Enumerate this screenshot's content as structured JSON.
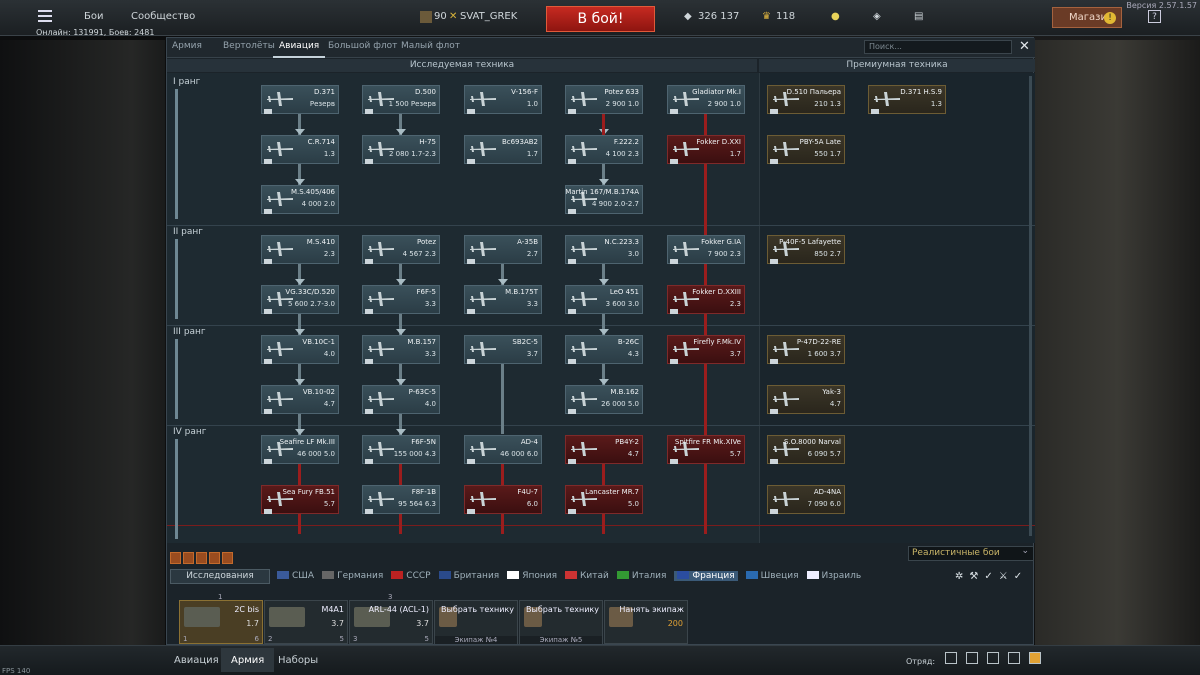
{
  "version": "Версия 2.57.1.57",
  "online": "Онлайн: 131991, Боев: 2481",
  "topbar": {
    "menu": "Бои",
    "community": "Сообщество",
    "level": "90",
    "player": "SVAT_GREK",
    "battle": "В бой!",
    "silver": "326 137",
    "gold": "118",
    "shop": "Магазин",
    "help": "?"
  },
  "tabs": [
    "Армия",
    "Вертолёты",
    "Авиация",
    "Большой флот",
    "Малый флот"
  ],
  "active_tab": "Авиация",
  "search_placeholder": "Поиск...",
  "sections": {
    "research": "Исследуемая техника",
    "premium": "Премиумная техника"
  },
  "ranks": [
    "I ранг",
    "II ранг",
    "III ранг",
    "IV ранг"
  ],
  "planes": [
    {
      "name": "D.371",
      "stat": "Резерв",
      "type": "researched"
    },
    {
      "name": "D.500",
      "stat": "1 500 Резерв",
      "type": "researched"
    },
    {
      "name": "V-156-F",
      "stat": "1.0",
      "type": "researched"
    },
    {
      "name": "Potez 633",
      "stat": "2 900 1.0",
      "type": "researched"
    },
    {
      "name": "Gladiator Mk.I",
      "stat": "2 900 1.0",
      "type": "researched"
    },
    {
      "name": "D.510 Пальера",
      "stat": "210 1.3",
      "type": "prem"
    },
    {
      "name": "D.371 H.S.9",
      "stat": "1.3",
      "type": "prem"
    },
    {
      "name": "C.R.714",
      "stat": "1.3",
      "type": "researched"
    },
    {
      "name": "H-75",
      "stat": "2 080 1.7-2.3",
      "type": "researched"
    },
    {
      "name": "Bc693AB2",
      "stat": "1.7",
      "type": "researched"
    },
    {
      "name": "F.222.2",
      "stat": "4 100 2.3",
      "type": "researched"
    },
    {
      "name": "Fokker D.XXI",
      "stat": "1.7",
      "type": "red"
    },
    {
      "name": "PBY-5A Late",
      "stat": "550 1.7",
      "type": "prem"
    },
    {
      "name": "M.S.405/406",
      "stat": "4 000 2.0",
      "type": "researched"
    },
    {
      "name": "Martin 167/M.B.174A",
      "stat": "4 900 2.0-2.7",
      "type": "researched"
    },
    {
      "name": "M.S.410",
      "stat": "2.3",
      "type": "researched"
    },
    {
      "name": "Potez",
      "stat": "4 567 2.3",
      "type": "researched"
    },
    {
      "name": "A-35B",
      "stat": "2.7",
      "type": "researched"
    },
    {
      "name": "N.C.223.3",
      "stat": "3.0",
      "type": "researched"
    },
    {
      "name": "Fokker G.IA",
      "stat": "7 900 2.3",
      "type": "researched"
    },
    {
      "name": "P-40F-5 Lafayette",
      "stat": "850 2.7",
      "type": "prem"
    },
    {
      "name": "VG.33C/D.520",
      "stat": "5 600 2.7-3.0",
      "type": "researched"
    },
    {
      "name": "F6F-5",
      "stat": "3.3",
      "type": "researched"
    },
    {
      "name": "M.B.175T",
      "stat": "3.3",
      "type": "researched"
    },
    {
      "name": "LeO 451",
      "stat": "3 600 3.0",
      "type": "researched"
    },
    {
      "name": "Fokker D.XXIII",
      "stat": "2.3",
      "type": "red"
    },
    {
      "name": "VB.10C-1",
      "stat": "4.0",
      "type": "researched"
    },
    {
      "name": "M.B.157",
      "stat": "3.3",
      "type": "researched"
    },
    {
      "name": "SB2C-5",
      "stat": "3.7",
      "type": "researched"
    },
    {
      "name": "B-26C",
      "stat": "4.3",
      "type": "researched"
    },
    {
      "name": "Firefly F.Mk.IV",
      "stat": "3.7",
      "type": "red"
    },
    {
      "name": "P-47D-22-RE",
      "stat": "1 600 3.7",
      "type": "prem"
    },
    {
      "name": "VB.10-02",
      "stat": "4.7",
      "type": "researched"
    },
    {
      "name": "P-63C-5",
      "stat": "4.0",
      "type": "researched"
    },
    {
      "name": "M.B.162",
      "stat": "26 000 5.0",
      "type": "researched"
    },
    {
      "name": "Yak-3",
      "stat": "4.7",
      "type": "prem"
    },
    {
      "name": "Seafire LF Mk.III",
      "stat": "46 000 5.0",
      "type": "researched"
    },
    {
      "name": "F6F-5N",
      "stat": "155 000 4.3",
      "type": "researched"
    },
    {
      "name": "AD-4",
      "stat": "46 000 6.0",
      "type": "researched"
    },
    {
      "name": "PB4Y-2",
      "stat": "4.7",
      "type": "red"
    },
    {
      "name": "Spitfire FR Mk.XIVe",
      "stat": "5.7",
      "type": "red"
    },
    {
      "name": "S.O.8000 Narval",
      "stat": "6 090 5.7",
      "type": "prem"
    },
    {
      "name": "Sea Fury FB.51",
      "stat": "5.7",
      "type": "red"
    },
    {
      "name": "F8F-1B",
      "stat": "95 564 6.3",
      "type": "researched"
    },
    {
      "name": "F4U-7",
      "stat": "6.0",
      "type": "red"
    },
    {
      "name": "Lancaster MR.7",
      "stat": "5.0",
      "type": "red"
    },
    {
      "name": "AD-4NA",
      "stat": "7 090 6.0",
      "type": "prem"
    }
  ],
  "mode": "Реалистичные бои",
  "research_btn": "Исследования",
  "nations": [
    "США",
    "Германия",
    "СССР",
    "Британия",
    "Япония",
    "Китай",
    "Италия",
    "Франция",
    "Швеция",
    "Израиль"
  ],
  "active_nation": "Франция",
  "crew": [
    {
      "name": "2C bis",
      "br": "1.7",
      "num": "1",
      "rep": "6",
      "top": "1"
    },
    {
      "name": "M4A1",
      "br": "3.7",
      "num": "2",
      "rep": "5",
      "top": ""
    },
    {
      "name": "ARL-44 (ACL-1)",
      "br": "3.7",
      "num": "3",
      "rep": "5",
      "top": "3"
    },
    {
      "name": "Выбрать технику",
      "label": "Экипаж №4"
    },
    {
      "name": "Выбрать технику",
      "label": "Экипаж №5"
    },
    {
      "name": "Нанять экипаж",
      "cost": "200"
    }
  ],
  "bottom": {
    "aviation": "Авиация",
    "army": "Армия",
    "sets": "Наборы",
    "squad": "Отряд:",
    "fps": "FPS 140"
  }
}
